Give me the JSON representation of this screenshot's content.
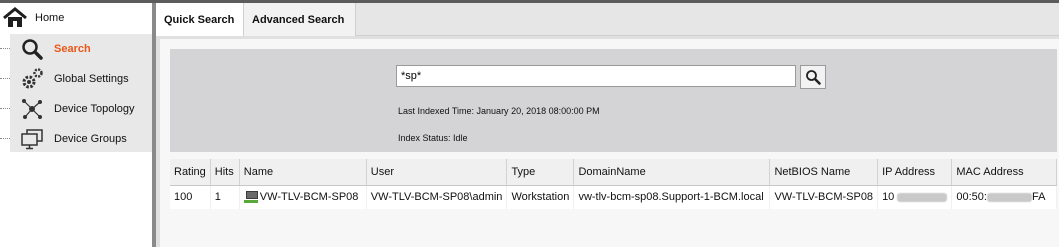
{
  "sidebar": {
    "home_label": "Home",
    "items": [
      {
        "label": "Search",
        "icon": "search-icon",
        "active": true
      },
      {
        "label": "Global Settings",
        "icon": "gear-icon",
        "active": false
      },
      {
        "label": "Device Topology",
        "icon": "topology-icon",
        "active": false
      },
      {
        "label": "Device Groups",
        "icon": "monitors-icon",
        "active": false
      }
    ]
  },
  "tabs": {
    "quick": "Quick Search",
    "advanced": "Advanced Search"
  },
  "search": {
    "value": "*sp*",
    "last_indexed": "Last Indexed Time: January 20, 2018 08:00:00 PM",
    "index_status": "Index Status: Idle"
  },
  "table": {
    "columns": [
      "Rating",
      "Hits",
      "Name",
      "User",
      "Type",
      "DomainName",
      "NetBIOS Name",
      "IP Address",
      "MAC Address"
    ],
    "rows": [
      {
        "rating": "100",
        "hits": "1",
        "name": "VW-TLV-BCM-SP08",
        "user": "VW-TLV-BCM-SP08\\admin",
        "type": "Workstation",
        "domain": "vw-tlv-bcm-sp08.Support-1-BCM.local",
        "netbios": "VW-TLV-BCM-SP08",
        "ip_prefix": "10",
        "mac_prefix": "00:50:",
        "mac_suffix": "FA"
      }
    ]
  },
  "colors": {
    "active_menu": "#e8581a",
    "panel": "#d4d4d6",
    "menu_bg": "#e8e8e8"
  }
}
